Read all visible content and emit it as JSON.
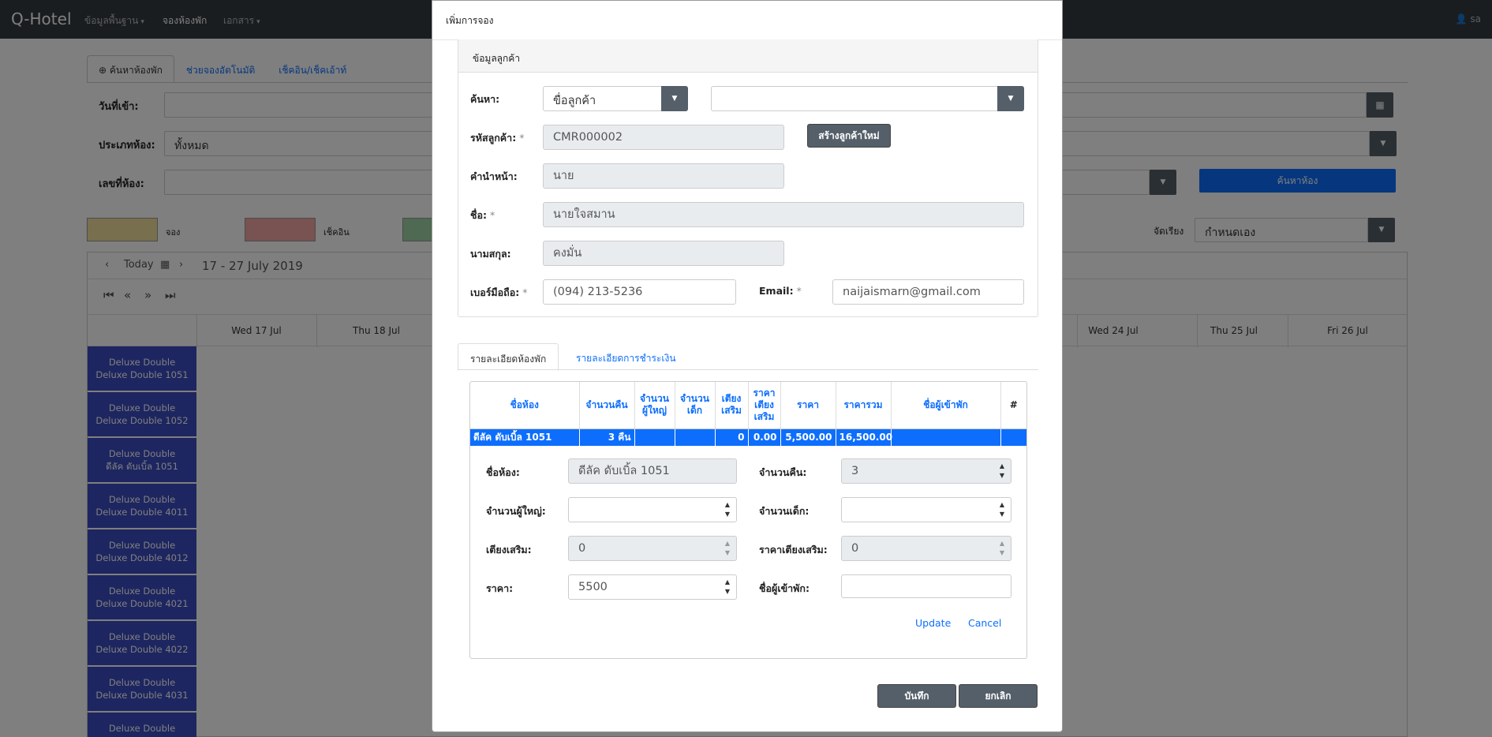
{
  "navbar": {
    "brand": "Q-Hotel",
    "items": [
      {
        "label": "ข้อมูลพื้นฐาน",
        "caret": "▾"
      },
      {
        "label": "จองห้องพัก",
        "caret": ""
      },
      {
        "label": "เอกสาร",
        "caret": "▾"
      }
    ],
    "user": "👤 sa"
  },
  "background": {
    "tabs": [
      "⊕ ค้นหาห้องพัก",
      "ช่วยจองอัตโนมัติ",
      "เช็คอิน/เช็คเอ้าท์"
    ],
    "fields": {
      "checkin_label": "วันที่เข้า:",
      "room_type_label": "ประเภทห้อง:",
      "room_type_value": "ทั้งหมด",
      "room_no_label": "เลขที่ห้อง:",
      "search_button": "ค้นหาห้อง",
      "sort_label": "จัดเรียง",
      "sort_value": "กำหนดเอง"
    },
    "legend": [
      {
        "label": "จอง",
        "color": "#f0df9c"
      },
      {
        "label": "เช็คอิน",
        "color": "#f2a4a4"
      },
      {
        "label": "",
        "color": "#9fd3a4"
      }
    ],
    "calendar": {
      "today_label": "Today",
      "date_range": "17 - 27 July 2019",
      "days": [
        "Wed 17 Jul",
        "Thu 18 Jul",
        "Wed 24 Jul",
        "Thu 25 Jul",
        "Fri 26 Jul"
      ],
      "rooms": [
        {
          "type": "Deluxe Double",
          "name": "Deluxe Double 1051"
        },
        {
          "type": "Deluxe Double",
          "name": "Deluxe Double 1052"
        },
        {
          "type": "Deluxe Double",
          "name": "ดีลัค ดับเบิ้ล 1051"
        },
        {
          "type": "Deluxe Double",
          "name": "Deluxe Double 4011"
        },
        {
          "type": "Deluxe Double",
          "name": "Deluxe Double 4012"
        },
        {
          "type": "Deluxe Double",
          "name": "Deluxe Double 4021"
        },
        {
          "type": "Deluxe Double",
          "name": "Deluxe Double 4022"
        },
        {
          "type": "Deluxe Double",
          "name": "Deluxe Double 4031"
        },
        {
          "type": "Deluxe Double",
          "name": ""
        }
      ]
    }
  },
  "modal": {
    "title": "เพิ่มการจอง",
    "customer_panel": {
      "heading": "ข้อมูลลูกค้า",
      "search_label": "ค้นหา:",
      "search_by": "ขื่อลูกค้า",
      "search_value": "",
      "code_label": "รหัสลูกค้า:",
      "code_value": "CMR000002",
      "new_customer_button": "สร้างลูกค้าใหม่",
      "prefix_label": "คำนำหน้า:",
      "prefix_value": "นาย",
      "first_name_label": "ชื่อ:",
      "first_name_value": "นายใจสมาน",
      "last_name_label": "นามสกุล:",
      "last_name_value": "คงมั่น",
      "phone_label": "เบอร์มือถือ:",
      "phone_value": "(094) 213-5236",
      "email_label": "Email:",
      "email_value": "naijaismarn@gmail.com",
      "required_mark": "*"
    },
    "tabs": [
      "รายละเอียดห้องพัก",
      "รายละเอียดการชำระเงิน"
    ],
    "grid": {
      "headers": [
        "ชื่อห้อง",
        "จำนวนคืน",
        "จำนวน ผู้ใหญ่",
        "จำนวน เด็ก",
        "เตียง เสริม",
        "ราคา เตียง เสริม",
        "ราคา",
        "ราคารวม",
        "ชื่อผู้เข้าพัก",
        "#"
      ],
      "row": [
        "ดีลัค ดับเบิ้ล 1051",
        "3 คืน",
        "",
        "",
        "0",
        "0.00",
        "5,500.00",
        "16,500.00",
        "",
        ""
      ]
    },
    "edit_form": {
      "room_label": "ชื่อห้อง:",
      "room_value": "ดีลัค ดับเบิ้ล 1051",
      "nights_label": "จำนวนคืน:",
      "nights_value": "3",
      "adults_label": "จำนวนผู้ใหญ่:",
      "adults_value": "",
      "children_label": "จำนวนเด็ก:",
      "children_value": "",
      "extra_bed_label": "เตียงเสริม:",
      "extra_bed_value": "0",
      "extra_bed_price_label": "ราคาเตียงเสริม:",
      "extra_bed_price_value": "0",
      "price_label": "ราคา:",
      "price_value": "5500",
      "guest_label": "ชื่อผู้เข้าพัก:",
      "guest_value": "",
      "update_link": "Update",
      "cancel_link": "Cancel"
    },
    "save_button": "บันทึก",
    "cancel_button": "ยกเลิก"
  }
}
